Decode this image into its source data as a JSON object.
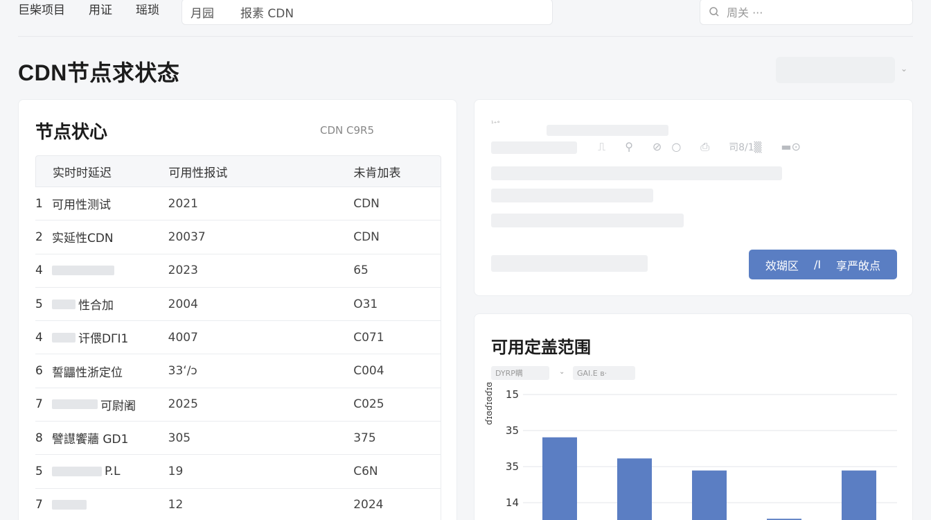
{
  "topbar": {
    "nav": [
      "巨柴项目",
      "用证",
      "瑶琐"
    ],
    "tabs": [
      "月园",
      "报素 CDN"
    ],
    "search_placeholder": "周关 ···"
  },
  "page": {
    "title": "CDN节点求状态"
  },
  "nodes_card": {
    "title": "节点状心",
    "subtitle": "CDN C9R5",
    "columns": [
      "实时时延迟",
      "可用性报试",
      "未肯加表"
    ],
    "rows": [
      {
        "num": "1",
        "name": "可用性测试",
        "blur": 0,
        "avail": "2021",
        "cdn": "CDN"
      },
      {
        "num": "2",
        "name": "实延性CDN",
        "blur": 0,
        "avail": "20037",
        "cdn": "CDN"
      },
      {
        "num": "4",
        "name": "",
        "blur": 90,
        "avail": "2023",
        "cdn": "65"
      },
      {
        "num": "5",
        "name": "性合加",
        "blur": 34,
        "avail": "2004",
        "cdn": "O31"
      },
      {
        "num": "4",
        "name": "讦偎DΓI1",
        "blur": 34,
        "avail": "4007",
        "cdn": "C071"
      },
      {
        "num": "6",
        "name": "誓鼺性浙定位",
        "blur": 0,
        "avail": "33ʻ∕ɔ",
        "cdn": "C004"
      },
      {
        "num": "7",
        "name": "可尉阇",
        "blur": 66,
        "avail": "2025",
        "cdn": "C025"
      },
      {
        "num": "8",
        "name": "譬譿饗蘠 GD1",
        "blur": 0,
        "avail": "305",
        "cdn": "375"
      },
      {
        "num": "5",
        "name": "P.L",
        "blur": 72,
        "avail": "19",
        "cdn": "C6N"
      },
      {
        "num": "7",
        "name": "",
        "blur": 50,
        "avail": "12",
        "cdn": "2024"
      }
    ]
  },
  "status_card": {
    "tiny_label": "¹⁺°",
    "icon_text": "司8/1▒",
    "button_left": "效瑚区",
    "button_sep": "/I",
    "button_right": "享严敀点"
  },
  "coverage_card": {
    "title": "可用定盖范围",
    "filter1": "DYRP瞒",
    "filter2": "GAI.E ʙ·",
    "y_axis_label": "ɗɪɞɗɪɞɗɪɞ"
  },
  "chart_data": {
    "type": "bar",
    "tick_labels": [
      "15",
      "35",
      "35",
      "14"
    ],
    "values": [
      35,
      28,
      24,
      8,
      24
    ],
    "ylim": [
      0,
      45
    ],
    "grid": true,
    "color": "#5b7ec3"
  },
  "colors": {
    "accent": "#5a7ec3",
    "bar": "#5b7ec3"
  }
}
